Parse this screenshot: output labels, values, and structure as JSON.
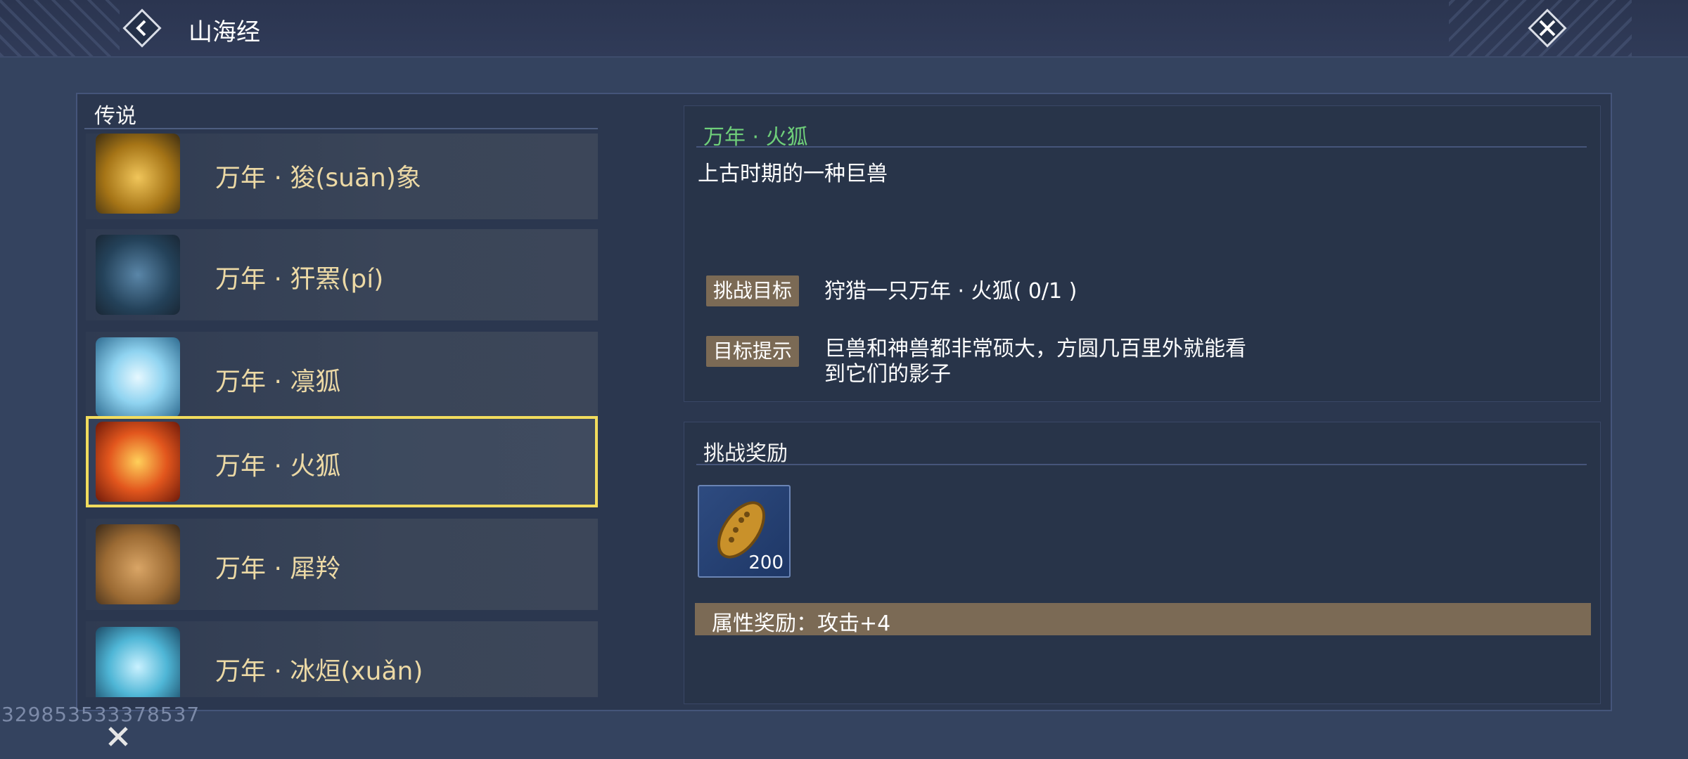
{
  "header": {
    "title": "山海经"
  },
  "sidebar": {
    "category_label": "传说",
    "items": [
      {
        "label": "万年 · 狻(suān)象",
        "icon": "golden-beast-icon",
        "color": "#c99a2e"
      },
      {
        "label": "万年 · 犴罴(pí)",
        "icon": "blue-wolf-icon",
        "color": "#2f5b7a"
      },
      {
        "label": "万年 · 凛狐",
        "icon": "ice-fox-icon",
        "color": "#8fd3f0"
      },
      {
        "label": "万年 · 火狐",
        "icon": "fire-fox-icon",
        "color": "#e2561d",
        "selected": true
      },
      {
        "label": "万年 · 犀羚",
        "icon": "horned-beast-icon",
        "color": "#b07a3b"
      },
      {
        "label": "万年 · 冰烜(xuǎn)",
        "icon": "ice-dragon-icon",
        "color": "#4fb6d6"
      }
    ]
  },
  "detail": {
    "name": "万年 · 火狐",
    "description": "上古时期的一种巨兽",
    "objective_tag": "挑战目标",
    "objective_text": "狩猎一只万年 · 火狐( 0/1 )",
    "hint_tag": "目标提示",
    "hint_line1": "巨兽和神兽都非常硕大，方圆几百里外就能看",
    "hint_line2": "到它们的影子"
  },
  "rewards": {
    "title": "挑战奖励",
    "item": {
      "icon": "seed-token-icon",
      "count": "200"
    },
    "attribute_text": "属性奖励：攻击+4"
  },
  "footer": {
    "id_text": "329853533378537"
  },
  "colors": {
    "accent_green": "#6fcf7a",
    "selected_outline": "#f2dc5d",
    "tag_bg": "#7b6a55"
  }
}
